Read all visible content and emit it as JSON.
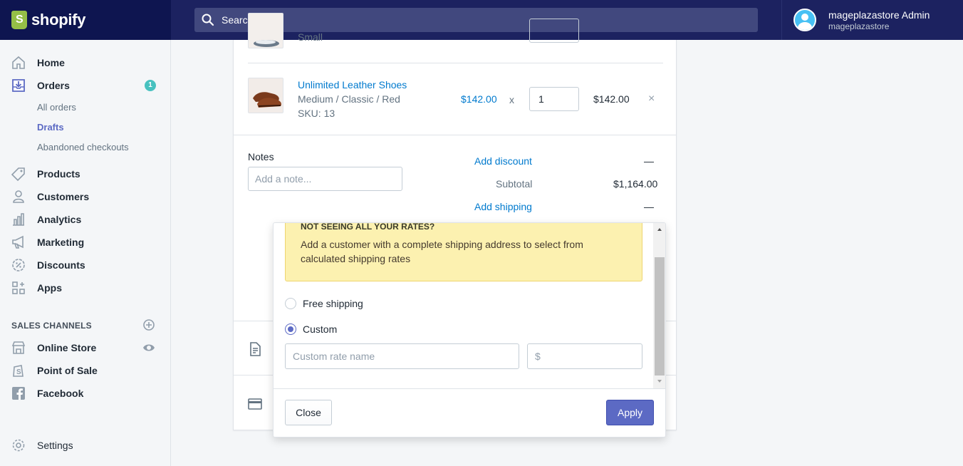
{
  "brand": {
    "name": "shopify"
  },
  "search": {
    "placeholder": "Search"
  },
  "user": {
    "name": "mageplazastore Admin",
    "store": "mageplazastore"
  },
  "sidebar": {
    "items": [
      {
        "label": "Home",
        "icon": "home-icon"
      },
      {
        "label": "Orders",
        "icon": "orders-icon",
        "badge": "1"
      },
      {
        "label": "Products",
        "icon": "tag-icon"
      },
      {
        "label": "Customers",
        "icon": "person-icon"
      },
      {
        "label": "Analytics",
        "icon": "bar-chart-icon"
      },
      {
        "label": "Marketing",
        "icon": "megaphone-icon"
      },
      {
        "label": "Discounts",
        "icon": "discount-icon"
      },
      {
        "label": "Apps",
        "icon": "apps-icon"
      }
    ],
    "orders_sub": [
      "All orders",
      "Drafts",
      "Abandoned checkouts"
    ],
    "sales_channels_title": "SALES CHANNELS",
    "channels": [
      {
        "label": "Online Store",
        "icon": "store-icon"
      },
      {
        "label": "Point of Sale",
        "icon": "pos-icon"
      },
      {
        "label": "Facebook",
        "icon": "facebook-icon"
      }
    ],
    "settings": "Settings"
  },
  "line_items": [
    {
      "variant_partial": "Small"
    },
    {
      "title": "Unlimited Leather Shoes",
      "variant": "Medium / Classic / Red",
      "sku": "SKU: 13",
      "price": "$142.00",
      "times": "x",
      "qty": "1",
      "total": "$142.00",
      "remove": "×"
    }
  ],
  "notes": {
    "label": "Notes",
    "placeholder": "Add a note..."
  },
  "summary": {
    "discount_link": "Add discount",
    "discount_value": "—",
    "subtotal_label": "Subtotal",
    "subtotal_value": "$1,164.00",
    "shipping_link": "Add shipping",
    "shipping_value": "—"
  },
  "shipping_popover": {
    "notice_title": "NOT SEEING ALL YOUR RATES?",
    "notice_body": "Add a customer with a complete shipping address to select from calculated shipping rates",
    "options": [
      {
        "label": "Free shipping",
        "selected": false
      },
      {
        "label": "Custom",
        "selected": true
      }
    ],
    "rate_name_placeholder": "Custom rate name",
    "price_placeholder": "$",
    "close_label": "Close",
    "apply_label": "Apply"
  },
  "colors": {
    "topbar": "#1c2260",
    "accent": "#5c6ac4",
    "link": "#007ace",
    "badge": "#47c1bf",
    "notice": "#fcf1b0"
  }
}
